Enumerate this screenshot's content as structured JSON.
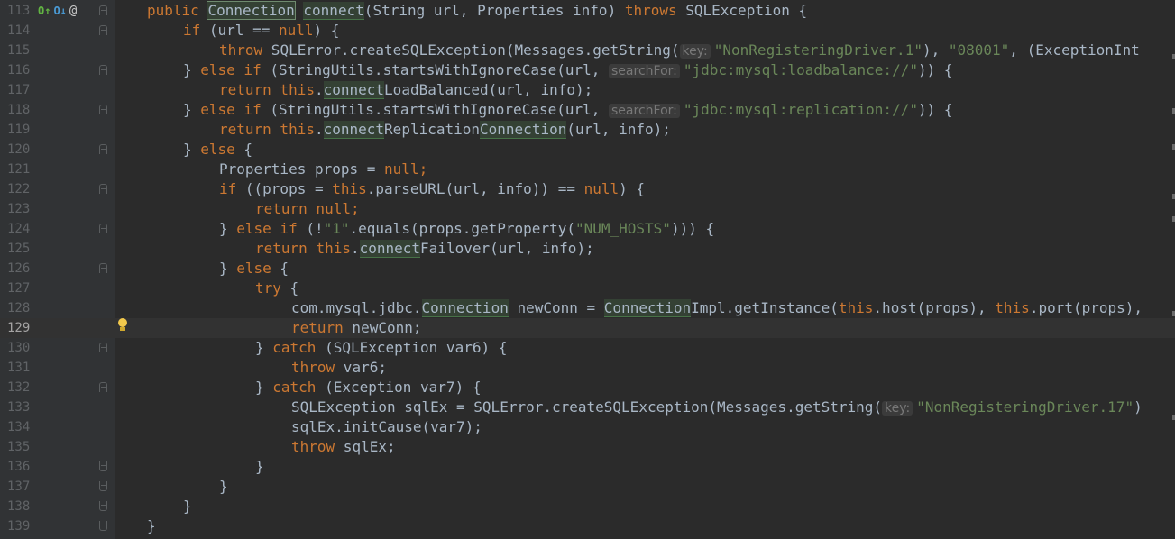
{
  "editor": {
    "current_line": 129,
    "colors": {
      "background": "#2b2b2b",
      "gutter": "#313335",
      "keyword": "#cc7832",
      "string": "#6a8759",
      "plain": "#a9b7c6",
      "usage_highlight": "#344134",
      "line_number": "#606366"
    },
    "gutter_icons": [
      "overrides-icon",
      "implemented-icon",
      "annotation-icon"
    ],
    "line_numbers": [
      "113",
      "114",
      "115",
      "116",
      "117",
      "118",
      "119",
      "120",
      "121",
      "122",
      "123",
      "124",
      "125",
      "126",
      "127",
      "128",
      "129",
      "130",
      "131",
      "132",
      "133",
      "134",
      "135",
      "136",
      "137",
      "138",
      "139"
    ],
    "hints": {
      "key": "key:",
      "search_for": "searchFor:"
    },
    "tokens": {
      "l113_a": "public",
      "l113_b": "Connection",
      "l113_c": "connect",
      "l113_d": "(String url, Properties info) ",
      "l113_e": "throws",
      "l113_f": " SQLException {",
      "l114_a": "if",
      "l114_b": " (url == ",
      "l114_c": "null",
      "l114_d": ") {",
      "l115_a": "throw",
      "l115_b": " SQLError.createSQLException(Messages.getString(",
      "l115_c": "\"NonRegisteringDriver.1\"",
      "l115_d": "), ",
      "l115_e": "\"08001\"",
      "l115_f": ", (ExceptionInt",
      "l116_a": "} ",
      "l116_b": "else if",
      "l116_c": " (StringUtils.startsWithIgnoreCase(url, ",
      "l116_d": "\"jdbc:mysql:loadbalance://\"",
      "l116_e": ")) {",
      "l117_a": "return this",
      "l117_b": ".",
      "l117_c": "connect",
      "l117_d": "LoadBalanced(url, info);",
      "l118_a": "} ",
      "l118_b": "else if",
      "l118_c": " (StringUtils.startsWithIgnoreCase(url, ",
      "l118_d": "\"jdbc:mysql:replication://\"",
      "l118_e": ")) {",
      "l119_a": "return this",
      "l119_b": ".",
      "l119_c": "connect",
      "l119_d": "Replication",
      "l119_e": "Connection",
      "l119_f": "(url, info);",
      "l120_a": "} ",
      "l120_b": "else",
      "l120_c": " {",
      "l121_a": "Properties props = ",
      "l121_b": "null",
      "l121_c": ";",
      "l122_a": "if",
      "l122_b": " ((props = ",
      "l122_c": "this",
      "l122_d": ".parseURL(url, info)) == ",
      "l122_e": "null",
      "l122_f": ") {",
      "l123_a": "return null",
      "l123_b": ";",
      "l124_a": "} ",
      "l124_b": "else if",
      "l124_c": " (!",
      "l124_d": "\"1\"",
      "l124_e": ".equals(props.getProperty(",
      "l124_f": "\"NUM_HOSTS\"",
      "l124_g": "))) {",
      "l125_a": "return this",
      "l125_b": ".",
      "l125_c": "connect",
      "l125_d": "Failover(url, info);",
      "l126_a": "} ",
      "l126_b": "else",
      "l126_c": " {",
      "l127_a": "try",
      "l127_b": " {",
      "l128_a": "com.mysql.jdbc.",
      "l128_b": "Connection",
      "l128_c": " newConn = ",
      "l128_d": "Connection",
      "l128_e": "Impl.getInstance(",
      "l128_f": "this",
      "l128_g": ".host(props), ",
      "l128_h": "this",
      "l128_i": ".port(props),",
      "l129_a": "return",
      "l129_b": " newConn;",
      "l130_a": "} ",
      "l130_b": "catch",
      "l130_c": " (SQLException var6) {",
      "l131_a": "throw",
      "l131_b": " var6;",
      "l132_a": "} ",
      "l132_b": "catch",
      "l132_c": " (Exception var7) {",
      "l133_a": "SQLException sqlEx = SQLError.createSQLException(Messages.getString(",
      "l133_b": "\"NonRegisteringDriver.17\"",
      "l133_c": ")",
      "l134_a": "sqlEx.initCause(var7);",
      "l135_a": "throw",
      "l135_b": " sqlEx;",
      "l136_a": "}",
      "l137_a": "}",
      "l138_a": "}",
      "l139_a": "}"
    }
  }
}
